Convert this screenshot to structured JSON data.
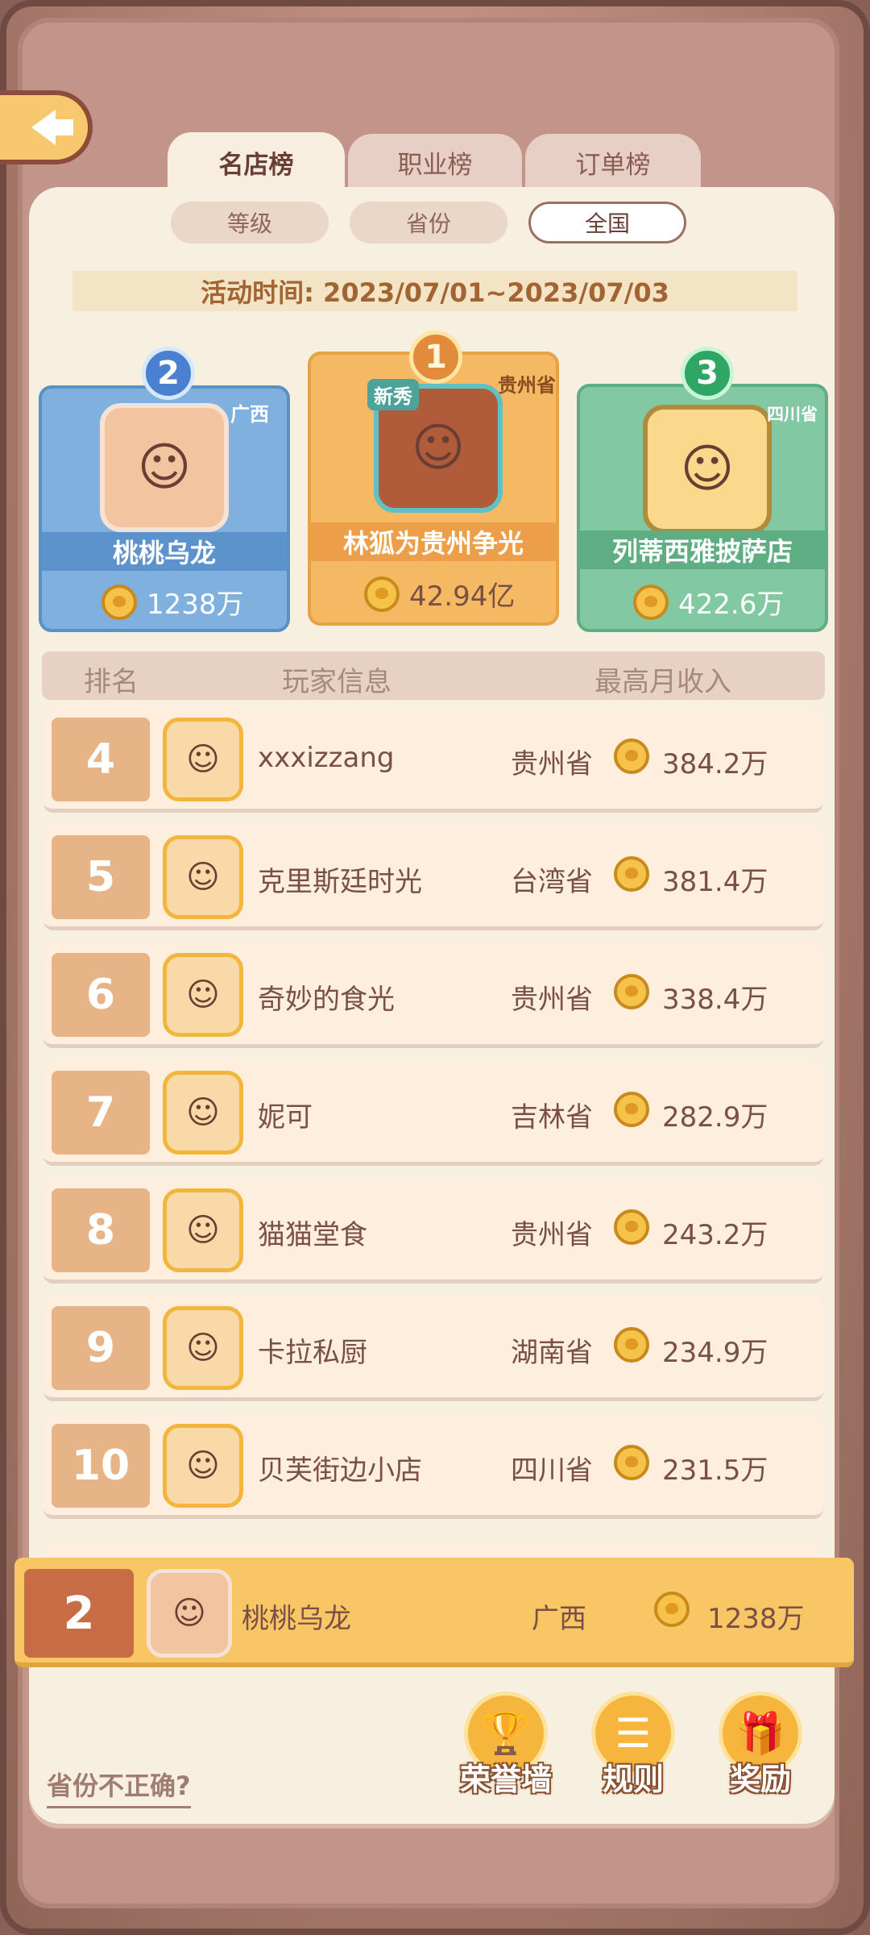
{
  "tabs": [
    {
      "label": "名店榜",
      "active": true
    },
    {
      "label": "职业榜",
      "active": false
    },
    {
      "label": "订单榜",
      "active": false
    }
  ],
  "filters": [
    {
      "label": "等级",
      "selected": false
    },
    {
      "label": "省份",
      "selected": false
    },
    {
      "label": "全国",
      "selected": true
    }
  ],
  "activity_time": "活动时间: 2023/07/01~2023/07/03",
  "podium": {
    "first": {
      "rank": "1",
      "name": "林狐为贵州争光",
      "province": "贵州省",
      "income": "42.94亿",
      "badge": "新秀"
    },
    "second": {
      "rank": "2",
      "name": "桃桃乌龙",
      "province": "广西",
      "income": "1238万"
    },
    "third": {
      "rank": "3",
      "name": "列蒂西雅披萨店",
      "province": "四川省",
      "income": "422.6万"
    }
  },
  "list_header": {
    "rank": "排名",
    "player": "玩家信息",
    "income": "最高月收入"
  },
  "rows": [
    {
      "rank": "4",
      "name": "xxxizzang",
      "province": "贵州省",
      "income": "384.2万"
    },
    {
      "rank": "5",
      "name": "克里斯廷时光",
      "province": "台湾省",
      "income": "381.4万"
    },
    {
      "rank": "6",
      "name": "奇妙的食光",
      "province": "贵州省",
      "income": "338.4万"
    },
    {
      "rank": "7",
      "name": "妮可",
      "province": "吉林省",
      "income": "282.9万"
    },
    {
      "rank": "8",
      "name": "猫猫堂食",
      "province": "贵州省",
      "income": "243.2万"
    },
    {
      "rank": "9",
      "name": "卡拉私厨",
      "province": "湖南省",
      "income": "234.9万"
    },
    {
      "rank": "10",
      "name": "贝芙街边小店",
      "province": "四川省",
      "income": "231.5万"
    }
  ],
  "my_rank": {
    "rank": "2",
    "name": "桃桃乌龙",
    "province": "广西",
    "income": "1238万"
  },
  "province_link": "省份不正确?",
  "bottom_buttons": [
    {
      "label": "荣誉墙",
      "icon": "trophy-icon"
    },
    {
      "label": "规则",
      "icon": "rules-icon"
    },
    {
      "label": "奖励",
      "icon": "gift-icon"
    }
  ],
  "colors": {
    "accent": "#f9c665",
    "panel": "#f7efe0",
    "rank_box": "#e7b487",
    "first_card": "#f5b863",
    "second_card": "#7fb0de",
    "third_card": "#82c8a2"
  }
}
